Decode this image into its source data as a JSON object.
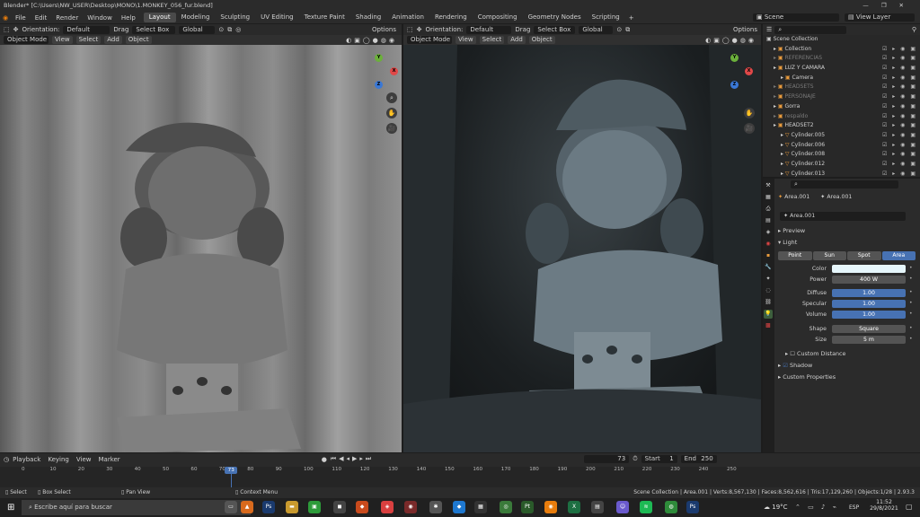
{
  "window": {
    "title": "Blender* [C:\\Users\\NW_USER\\Desktop\\MONO\\1.MONKEY_056_fur.blend]",
    "controls": [
      "—",
      "❐",
      "✕"
    ]
  },
  "menubar": {
    "items": [
      "File",
      "Edit",
      "Render",
      "Window",
      "Help"
    ],
    "workspaces": [
      "Layout",
      "Modeling",
      "Sculpting",
      "UV Editing",
      "Texture Paint",
      "Shading",
      "Animation",
      "Rendering",
      "Compositing",
      "Geometry Nodes",
      "Scripting"
    ],
    "active_workspace": "Layout",
    "add_tab": "+",
    "scene": "Scene",
    "view_layer": "View Layer"
  },
  "toolheader_left": {
    "orientation_label": "Orientation:",
    "orientation_value": "Default",
    "drag_label": "Drag",
    "drag_value": "Select Box",
    "transform": "Global",
    "options": "Options"
  },
  "toolheader_right": {
    "orientation_label": "Orientation:",
    "orientation_value": "Default",
    "drag_label": "Drag",
    "drag_value": "Select Box",
    "transform": "Global",
    "options": "Options"
  },
  "viewport_header": {
    "mode": "Object Mode",
    "menus": [
      "View",
      "Select",
      "Add",
      "Object"
    ]
  },
  "gizmo": {
    "x": "X",
    "y": "Y",
    "z": "Z"
  },
  "outliner": {
    "root": "Scene Collection",
    "rows": [
      {
        "label": "Collection",
        "dim": false,
        "indent": 1
      },
      {
        "label": "REFERENCIAS",
        "dim": true,
        "indent": 1
      },
      {
        "label": "LUZ Y CAMARA",
        "dim": false,
        "indent": 1
      },
      {
        "label": "Camera",
        "dim": false,
        "indent": 2
      },
      {
        "label": "HEADSETS",
        "dim": true,
        "indent": 1
      },
      {
        "label": "PERSONAJE",
        "dim": true,
        "indent": 1
      },
      {
        "label": "Gorra",
        "dim": false,
        "indent": 1
      },
      {
        "label": "respaldo",
        "dim": true,
        "indent": 1
      },
      {
        "label": "HEADSET2",
        "dim": false,
        "indent": 1
      },
      {
        "label": "Cylinder.005",
        "dim": false,
        "indent": 2
      },
      {
        "label": "Cylinder.006",
        "dim": false,
        "indent": 2
      },
      {
        "label": "Cylinder.008",
        "dim": false,
        "indent": 2
      },
      {
        "label": "Cylinder.012",
        "dim": false,
        "indent": 2
      },
      {
        "label": "Cylinder.013",
        "dim": false,
        "indent": 2
      }
    ]
  },
  "properties": {
    "breadcrumb_object": "Area.001",
    "breadcrumb_data": "Area.001",
    "datablock": "Area.001",
    "preview_panel": "Preview",
    "light_panel": "Light",
    "light_types": [
      "Point",
      "Sun",
      "Spot",
      "Area"
    ],
    "active_light_type": "Area",
    "fields": [
      {
        "label": "Color",
        "value": "",
        "style": "color"
      },
      {
        "label": "Power",
        "value": "400 W",
        "style": "dark"
      },
      {
        "label": "Diffuse",
        "value": "1.00",
        "style": "blue"
      },
      {
        "label": "Specular",
        "value": "1.00",
        "style": "blue"
      },
      {
        "label": "Volume",
        "value": "1.00",
        "style": "blue"
      },
      {
        "label": "Shape",
        "value": "Square",
        "style": "dark"
      },
      {
        "label": "Size",
        "value": "5 m",
        "style": "dark"
      }
    ],
    "custom_distance": "Custom Distance",
    "shadow": "Shadow",
    "custom_properties": "Custom Properties",
    "light_color": "#e6f6fb"
  },
  "timeline": {
    "menus": [
      "Playback",
      "Keying",
      "View",
      "Marker"
    ],
    "current_frame": "73",
    "start_label": "Start",
    "start": "1",
    "end_label": "End",
    "end": "250",
    "ticks": [
      "0",
      "10",
      "20",
      "30",
      "40",
      "50",
      "60",
      "70",
      "80",
      "90",
      "100",
      "110",
      "120",
      "130",
      "140",
      "150",
      "160",
      "170",
      "180",
      "190",
      "200",
      "210",
      "220",
      "230",
      "240",
      "250"
    ],
    "playhead_label": "73"
  },
  "statusbar": {
    "select": "Select",
    "box_select": "Box Select",
    "pan_view": "Pan View",
    "context_menu": "Context Menu",
    "stats": "Scene Collection | Area.001 | Verts:8,567,130 | Faces:8,562,616 | Tris:17,129,260 | Objects:1/28 | 2.93.3"
  },
  "taskbar": {
    "search_placeholder": "Escribe aquí para buscar",
    "weather": "19°C",
    "lang": "ESP",
    "time": "11:52",
    "date": "29/8/2021"
  }
}
